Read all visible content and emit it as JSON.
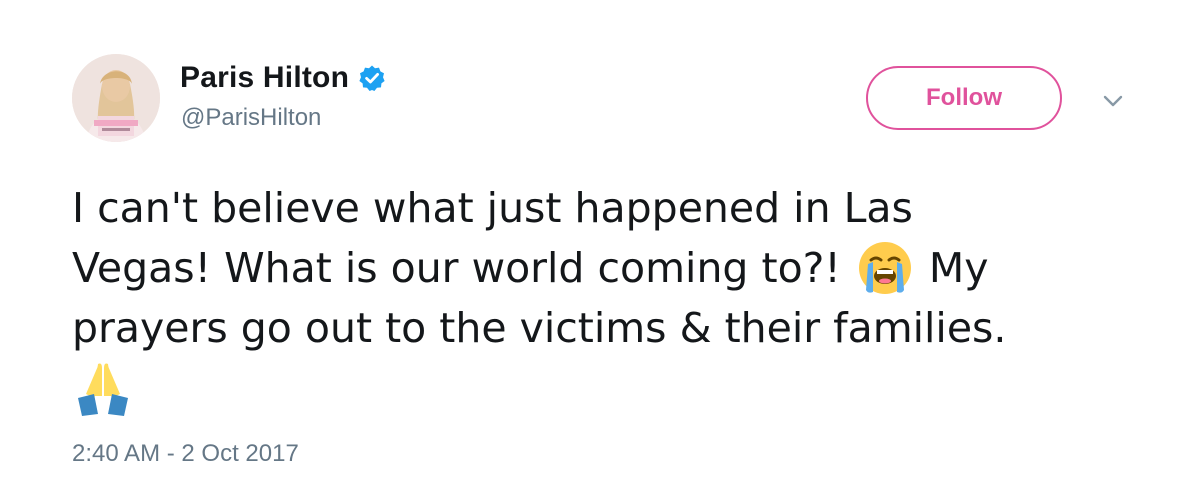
{
  "author": {
    "display_name": "Paris Hilton",
    "handle": "@ParisHilton",
    "verified": true
  },
  "actions": {
    "follow_label": "Follow",
    "more_menu_icon": "chevron-down-icon"
  },
  "tweet": {
    "line1": "I can't believe what just happened in Las",
    "line2_part1": "Vegas! What is our world coming to?! ",
    "line2_emoji": "loudly-crying-face-emoji",
    "line2_part2": " My",
    "line3": "prayers go out to the victims & their families.",
    "line4_emoji": "folded-hands-emoji",
    "timestamp": "2:40 AM - 2 Oct 2017"
  },
  "colors": {
    "follow_accent": "#e0529c",
    "verified_badge": "#1da1f2",
    "secondary_text": "#657786",
    "primary_text": "#14171a"
  }
}
